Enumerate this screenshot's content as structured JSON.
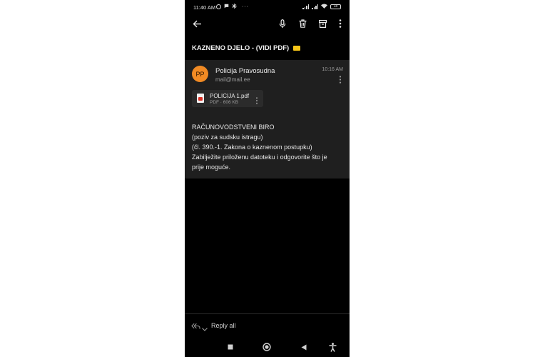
{
  "status_bar": {
    "time": "11:40 AM",
    "battery": "38"
  },
  "toolbar": {
    "back_icon": "arrow-left-icon",
    "mic_icon": "microphone-icon",
    "delete_icon": "trash-icon",
    "archive_icon": "archive-icon",
    "more_icon": "more-vert-icon"
  },
  "email": {
    "subject": "KAZNENO DJELO - (VIDI PDF)",
    "sender": {
      "initials": "PP",
      "name": "Policija Pravosudna",
      "email": "mail@mail.ee",
      "avatar_color": "#f08a24"
    },
    "time": "10:16 AM",
    "attachment": {
      "name": "POLICIJA 1.pdf",
      "meta": "PDF · 606 KB"
    },
    "body_lines": [
      "RAČUNOVODSTVENI BIRO",
      "(poziv za sudsku istragu)",
      "(čl. 390.-1. Zakona o kaznenom postupku)",
      "Zabilježite priloženu datoteku i odgovorite što je",
      "prije moguće."
    ]
  },
  "reply": {
    "label": "Reply all"
  },
  "colors": {
    "background": "#000000",
    "card": "#1f1f1f",
    "accent": "#f08a24"
  }
}
